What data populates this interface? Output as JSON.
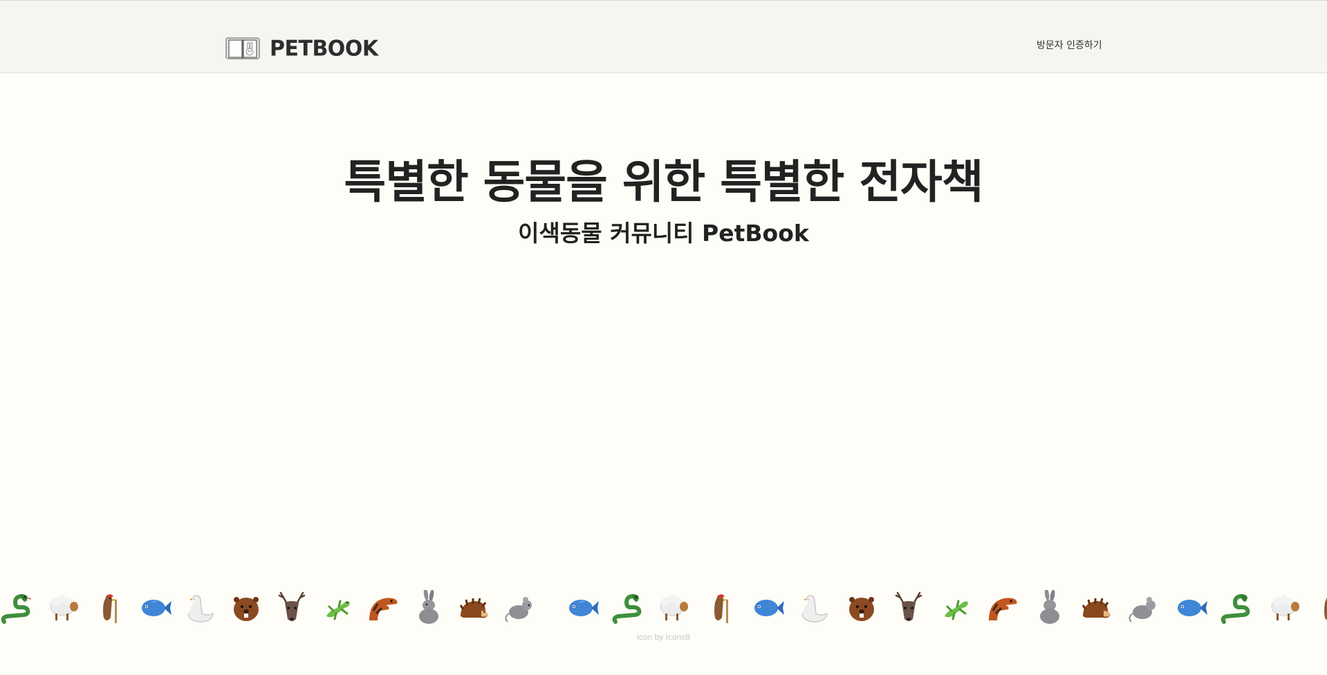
{
  "header": {
    "logo_text": "PETBOOK",
    "visitor_link": "방문자 인증하기"
  },
  "hero": {
    "title": "특별한 동물을 위한 특별한 전자책",
    "subtitle": "이색동물 커뮤니티 PetBook"
  },
  "animals": [
    "snake-icon",
    "sheep-icon",
    "woodpecker-icon",
    "fish-icon",
    "swan-icon",
    "beaver-icon",
    "deer-icon",
    "lizard-icon",
    "dinosaur-icon",
    "rabbit-icon",
    "hedgehog-icon",
    "mouse-icon",
    "fish-icon",
    "snake-icon",
    "sheep-icon",
    "woodpecker-icon",
    "fish-icon",
    "swan-icon",
    "beaver-icon",
    "deer-icon",
    "lizard-icon",
    "dinosaur-icon",
    "rabbit-icon",
    "hedgehog-icon",
    "mouse-icon",
    "fish-icon",
    "snake-icon",
    "sheep-icon",
    "woodpecker-icon"
  ],
  "footer": {
    "credit": "icon by Icons8"
  },
  "colors": {
    "background": "#fffdf7",
    "header_background": "#f6f5f1",
    "text": "#222222",
    "credit_text": "#c8c8c8"
  }
}
